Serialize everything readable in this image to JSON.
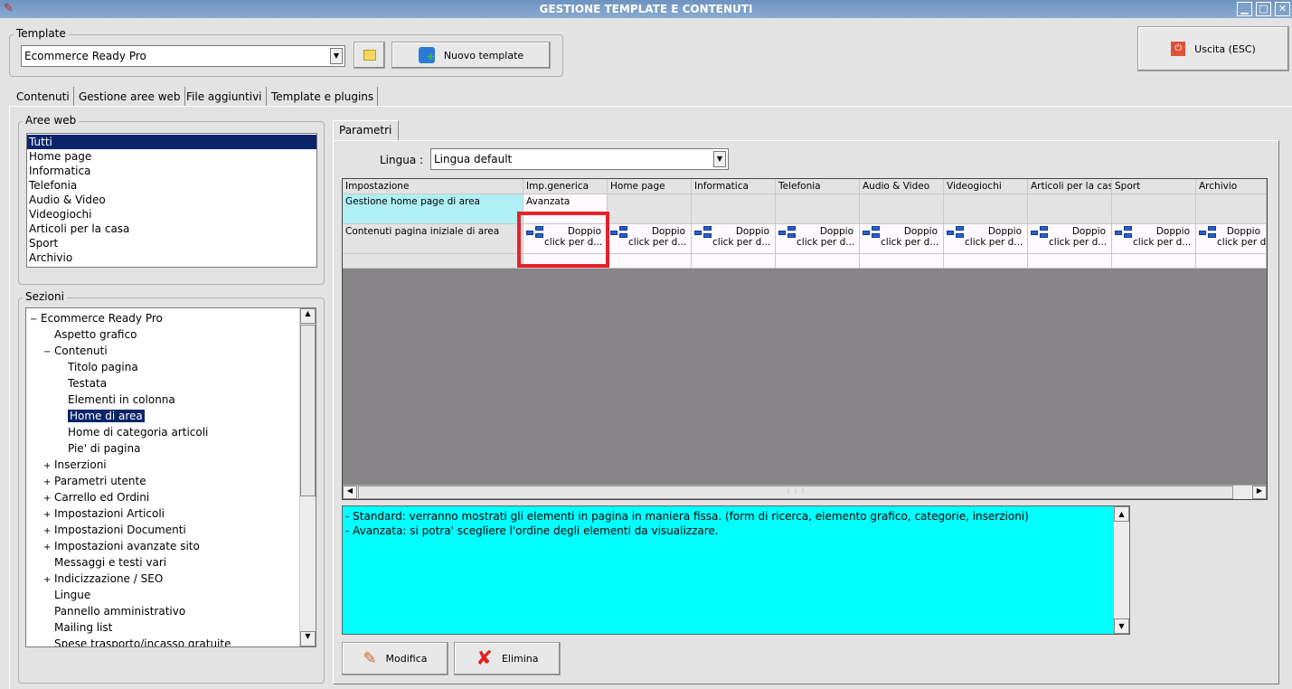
{
  "window": {
    "title": "GESTIONE TEMPLATE E CONTENUTI",
    "min": "▁",
    "max": "□",
    "close": "✕"
  },
  "template": {
    "legend": "Template",
    "selected": "Ecommerce Ready Pro",
    "new_button": "Nuovo template"
  },
  "exit_button": "Uscita (ESC)",
  "tabs": [
    "Contenuti",
    "Gestione aree web",
    "File aggiuntivi",
    "Template e plugins"
  ],
  "aree_web": {
    "legend": "Aree web",
    "items": [
      "Tutti",
      "Home page",
      "Informatica",
      "Telefonia",
      "Audio & Video",
      "Videogiochi",
      "Articoli per la casa",
      "Sport",
      "Archivio"
    ],
    "selected": 0
  },
  "sezioni": {
    "legend": "Sezioni",
    "items": [
      {
        "label": "Ecommerce Ready Pro",
        "level": 0,
        "toggle": "−"
      },
      {
        "label": "Aspetto grafico",
        "level": 1,
        "toggle": ""
      },
      {
        "label": "Contenuti",
        "level": 1,
        "toggle": "−"
      },
      {
        "label": "Titolo pagina",
        "level": 2,
        "toggle": ""
      },
      {
        "label": "Testata",
        "level": 2,
        "toggle": ""
      },
      {
        "label": "Elementi in colonna",
        "level": 2,
        "toggle": ""
      },
      {
        "label": "Home di area",
        "level": 2,
        "toggle": "",
        "selected": true
      },
      {
        "label": "Home di categoria articoli",
        "level": 2,
        "toggle": ""
      },
      {
        "label": "Pie' di pagina",
        "level": 2,
        "toggle": ""
      },
      {
        "label": "Inserzioni",
        "level": 1,
        "toggle": "+"
      },
      {
        "label": "Parametri utente",
        "level": 1,
        "toggle": "+"
      },
      {
        "label": "Carrello ed Ordini",
        "level": 1,
        "toggle": "+"
      },
      {
        "label": "Impostazioni Articoli",
        "level": 1,
        "toggle": "+"
      },
      {
        "label": "Impostazioni Documenti",
        "level": 1,
        "toggle": "+"
      },
      {
        "label": "Impostazioni avanzate sito",
        "level": 1,
        "toggle": "+"
      },
      {
        "label": "Messaggi e testi vari",
        "level": 1,
        "toggle": ""
      },
      {
        "label": "Indicizzazione / SEO",
        "level": 1,
        "toggle": "+"
      },
      {
        "label": "Lingue",
        "level": 1,
        "toggle": ""
      },
      {
        "label": "Pannello amministrativo",
        "level": 1,
        "toggle": ""
      },
      {
        "label": "Mailing list",
        "level": 1,
        "toggle": ""
      },
      {
        "label": "Spese trasporto/incasso gratuite",
        "level": 1,
        "toggle": ""
      }
    ]
  },
  "parametri": {
    "tab": "Parametri",
    "lingua_label": "Lingua :",
    "lingua_value": "Lingua default",
    "columns": [
      "Impostazione",
      "Imp.generica",
      "Home page",
      "Informatica",
      "Telefonia",
      "Audio & Video",
      "Videogiochi",
      "Articoli per la casa",
      "Sport",
      "Archivio"
    ],
    "rows": [
      {
        "label": "Gestione home page di area",
        "values": [
          "Avanzata",
          "",
          "",
          "",
          "",
          "",
          "",
          "",
          ""
        ]
      },
      {
        "label": "Contenuti pagina iniziale di area",
        "values": [
          "Doppio|click per d...",
          "Doppio|click per d...",
          "Doppio|click per d...",
          "Doppio|click per d...",
          "Doppio|click per d...",
          "Doppio|click per d...",
          "Doppio|click per d...",
          "Doppio|click per d...",
          "Doppio|click per d..."
        ]
      }
    ],
    "description": [
      "- Standard: verranno mostrati gli elementi in pagina in maniera fissa. (form di ricerca, elemento grafico, categorie, inserzioni)",
      "- Avanzata: si potra' scegliere l'ordine degli elementi da visualizzare."
    ],
    "modifica": "Modifica",
    "elimina": "Elimina"
  },
  "colors": {
    "highlight": "#e8202a",
    "desc_bg": "#00ffff",
    "row_label_bg": "#b0f0f5"
  }
}
